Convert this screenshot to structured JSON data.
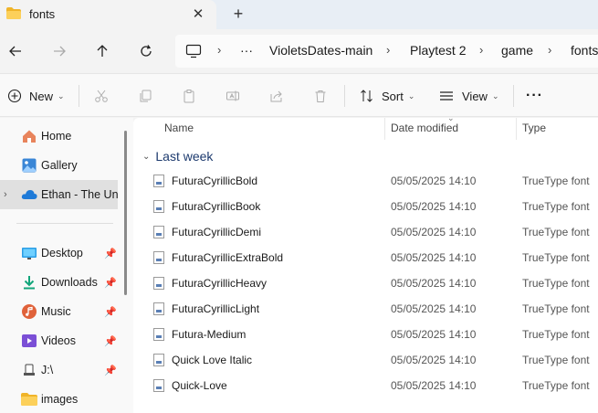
{
  "window": {
    "tab_title": "fonts",
    "close_glyph": "✕",
    "newtab_glyph": "+"
  },
  "address": {
    "more_glyph": "···",
    "crumbs": [
      "VioletsDates-main",
      "Playtest 2",
      "game",
      "fonts"
    ]
  },
  "toolbar": {
    "new_label": "New",
    "sort_label": "Sort",
    "view_label": "View",
    "more_glyph": "···"
  },
  "sidebar": {
    "items": [
      {
        "label": "Home",
        "icon": "home-icon"
      },
      {
        "label": "Gallery",
        "icon": "gallery-icon"
      },
      {
        "label": "Ethan - The University",
        "icon": "onedrive-cloud-icon"
      },
      {
        "label": "Desktop",
        "icon": "desktop-icon"
      },
      {
        "label": "Downloads",
        "icon": "downloads-icon"
      },
      {
        "label": "Music",
        "icon": "music-icon"
      },
      {
        "label": "Videos",
        "icon": "videos-icon"
      },
      {
        "label": "J:\\",
        "icon": "drive-icon"
      },
      {
        "label": "images",
        "icon": "folder-icon"
      }
    ]
  },
  "columns": {
    "name": "Name",
    "date": "Date modified",
    "type": "Type"
  },
  "group": {
    "label": "Last week"
  },
  "files": [
    {
      "name": "FuturaCyrillicBold",
      "date": "05/05/2025 14:10",
      "type": "TrueType font"
    },
    {
      "name": "FuturaCyrillicBook",
      "date": "05/05/2025 14:10",
      "type": "TrueType font"
    },
    {
      "name": "FuturaCyrillicDemi",
      "date": "05/05/2025 14:10",
      "type": "TrueType font"
    },
    {
      "name": "FuturaCyrillicExtraBold",
      "date": "05/05/2025 14:10",
      "type": "TrueType font"
    },
    {
      "name": "FuturaCyrillicHeavy",
      "date": "05/05/2025 14:10",
      "type": "TrueType font"
    },
    {
      "name": "FuturaCyrillicLight",
      "date": "05/05/2025 14:10",
      "type": "TrueType font"
    },
    {
      "name": "Futura-Medium",
      "date": "05/05/2025 14:10",
      "type": "TrueType font"
    },
    {
      "name": "Quick Love Italic",
      "date": "05/05/2025 14:10",
      "type": "TrueType font"
    },
    {
      "name": "Quick-Love",
      "date": "05/05/2025 14:10",
      "type": "TrueType font"
    }
  ]
}
